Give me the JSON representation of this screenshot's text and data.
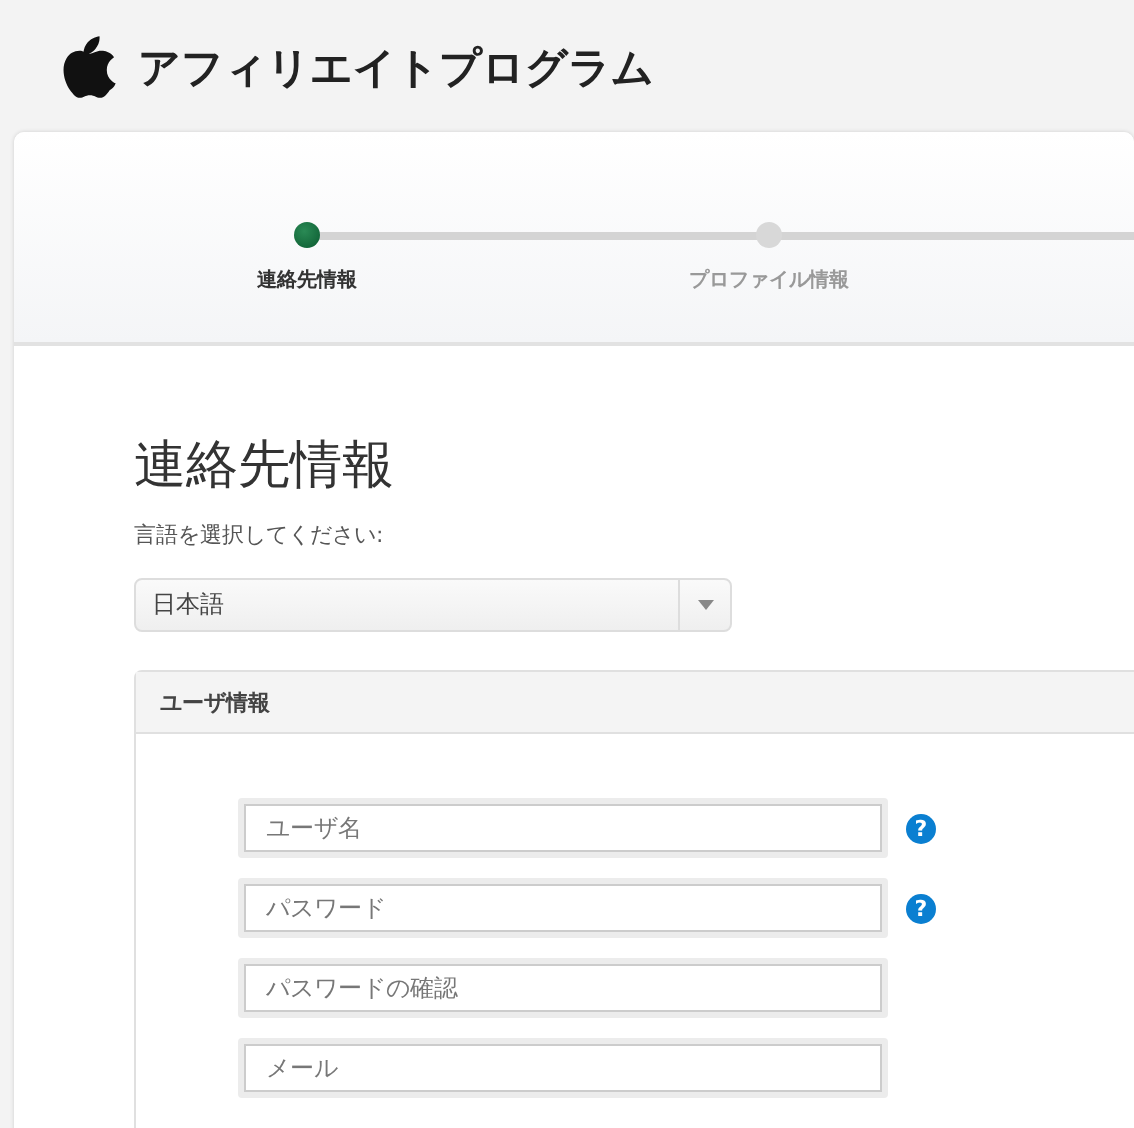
{
  "header": {
    "title": "アフィリエイトプログラム"
  },
  "steps": [
    {
      "label": "連絡先情報",
      "selected": true
    },
    {
      "label": "プロファイル情報",
      "selected": false
    }
  ],
  "heading": "連絡先情報",
  "language": {
    "label": "言語を選択してください:",
    "value": "日本語"
  },
  "panel": {
    "title": "ユーザ情報",
    "help_glyph": "?",
    "fields": [
      {
        "placeholder": "ユーザ名",
        "help": true
      },
      {
        "placeholder": "パスワード",
        "help": true
      },
      {
        "placeholder": "パスワードの確認",
        "help": false
      },
      {
        "placeholder": "メール",
        "help": false
      }
    ]
  }
}
